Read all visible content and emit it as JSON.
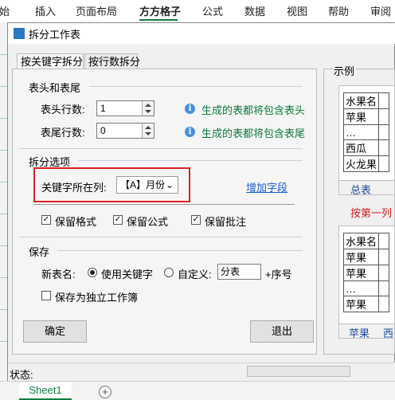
{
  "ribbon": {
    "tabs": [
      "始",
      "插入",
      "页面布局",
      "方方格子",
      "公式",
      "数据",
      "视图",
      "帮助",
      "审阅"
    ],
    "active_tab": "方方格子"
  },
  "dialog": {
    "title": "拆分工作表",
    "tabs": [
      {
        "label": "按关键字拆分",
        "active": true
      },
      {
        "label": "按行数拆分",
        "active": false
      }
    ],
    "header_footer": {
      "group_title": "表头和表尾",
      "header_rows_label": "表头行数:",
      "header_rows_value": "1",
      "footer_rows_label": "表尾行数:",
      "footer_rows_value": "0",
      "header_info": "生成的表都将包含表头",
      "footer_info": "生成的表都将包含表尾"
    },
    "split_options": {
      "group_title": "拆分选项",
      "keyword_col_label": "关键字所在列:",
      "keyword_col_value": "【A】月份",
      "add_field_link": "增加字段",
      "checkboxes": [
        {
          "label": "保留格式",
          "checked": true
        },
        {
          "label": "保留公式",
          "checked": true
        },
        {
          "label": "保留批注",
          "checked": true
        }
      ]
    },
    "save": {
      "group_title": "保存",
      "new_name_label": "新表名:",
      "radio_keyword": "使用关键字",
      "radio_custom": "自定义:",
      "custom_value": "分表",
      "suffix": "+序号",
      "standalone_label": "保存为独立工作簿"
    },
    "buttons": {
      "ok": "确定",
      "exit": "退出"
    },
    "status_label": "状态:"
  },
  "example": {
    "title": "示例",
    "table1": [
      "水果名",
      "苹果",
      "…",
      "西瓜",
      "火龙果"
    ],
    "sheet_tab1": "总表",
    "caption": "按第一列",
    "table2": [
      "水果名",
      "苹果",
      "苹果",
      "…",
      "苹果"
    ],
    "sheet_tab2a": "苹果",
    "sheet_tab2b": "西"
  },
  "workbook": {
    "sheet_tab": "Sheet1",
    "add_sheet": "+"
  },
  "colors": {
    "accent_green": "#107c41",
    "highlight_red": "#e02020",
    "link_blue": "#1a5dc9",
    "info_green": "#0c7a3d"
  }
}
